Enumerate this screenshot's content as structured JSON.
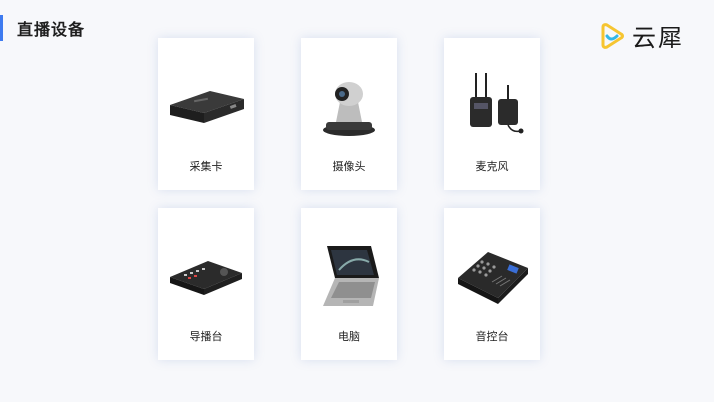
{
  "header": {
    "title": "直播设备"
  },
  "logo": {
    "text": "云犀",
    "icon": "logo-play-icon"
  },
  "devices": [
    {
      "label": "采集卡",
      "icon": "capture-card-icon"
    },
    {
      "label": "摄像头",
      "icon": "camera-icon"
    },
    {
      "label": "麦克风",
      "icon": "microphone-icon"
    },
    {
      "label": "导播台",
      "icon": "switcher-icon"
    },
    {
      "label": "电脑",
      "icon": "laptop-icon"
    },
    {
      "label": "音控台",
      "icon": "mixer-icon"
    }
  ],
  "colors": {
    "accent": "#3e7bf0",
    "logo_yellow": "#f6c531",
    "logo_blue": "#33b7e8"
  }
}
